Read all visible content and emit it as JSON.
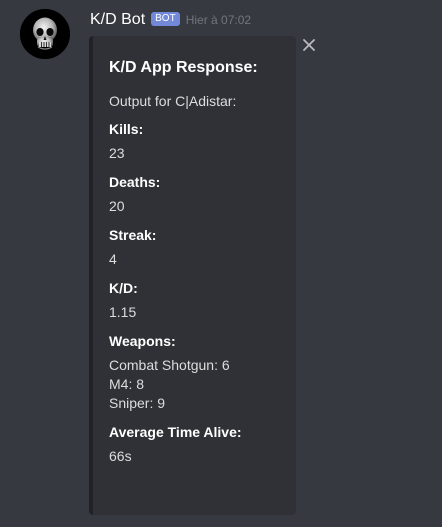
{
  "message": {
    "avatar_icon": "skull-icon",
    "username": "K/D Bot",
    "bot_tag": "BOT",
    "timestamp": "Hier à 07:02"
  },
  "embed": {
    "title": "K/D App Response:",
    "description": "Output for C|Adistar:",
    "fields": [
      {
        "name": "Kills:",
        "values": [
          "23"
        ]
      },
      {
        "name": "Deaths:",
        "values": [
          "20"
        ]
      },
      {
        "name": "Streak:",
        "values": [
          "4"
        ]
      },
      {
        "name": "K/D:",
        "values": [
          "1.15"
        ]
      },
      {
        "name": "Weapons:",
        "values": [
          "Combat Shotgun: 6",
          "M4: 8",
          "Sniper: 9"
        ]
      },
      {
        "name": "Average Time Alive:",
        "values": [
          "66s"
        ]
      }
    ],
    "close_icon": "close-icon"
  },
  "colors": {
    "background": "#36393f",
    "embed_background": "#2f3136",
    "embed_border": "#202225",
    "bot_tag": "#7289da"
  }
}
